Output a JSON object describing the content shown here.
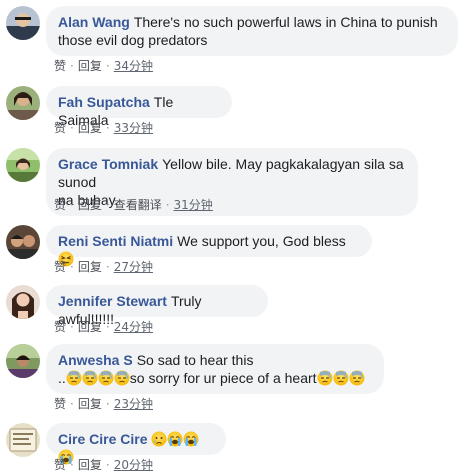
{
  "actions": {
    "like": "赞",
    "reply": "回复",
    "translate": "查看翻译",
    "separator": "·"
  },
  "comments": [
    {
      "name": "Alan Wang",
      "line1": "There's no such powerful laws in China to punish",
      "line2": "those evil dog predators",
      "time": "34分钟"
    },
    {
      "name": "Fah Supatcha",
      "line1": "Tle Saimala",
      "time": "33分钟"
    },
    {
      "name": "Grace Tomniak",
      "line1": "Yellow bile. May pagkakalagyan sila sa sunod",
      "line2": "na buhay.",
      "time": "31分钟"
    },
    {
      "name": "Reni Senti Niatmi",
      "line1": "We support you, God bless",
      "time": "27分钟"
    },
    {
      "name": "Jennifer Stewart",
      "line1": "Truly awful!!!!!!",
      "time": "24分钟"
    },
    {
      "name": "Anwesha S",
      "line1": "So sad to hear this",
      "line2a": "..",
      "line2b": "so sorry for ur piece of a heart",
      "time": "23分钟"
    },
    {
      "name": "Cire Cire Cire",
      "line1": "",
      "time": "20分钟"
    }
  ],
  "emoji": {
    "persevere": "persevering-face",
    "downcast_sweat": "downcast-sweat-face",
    "crying": "crying-face",
    "loudly_crying": "loudly-crying-face"
  }
}
